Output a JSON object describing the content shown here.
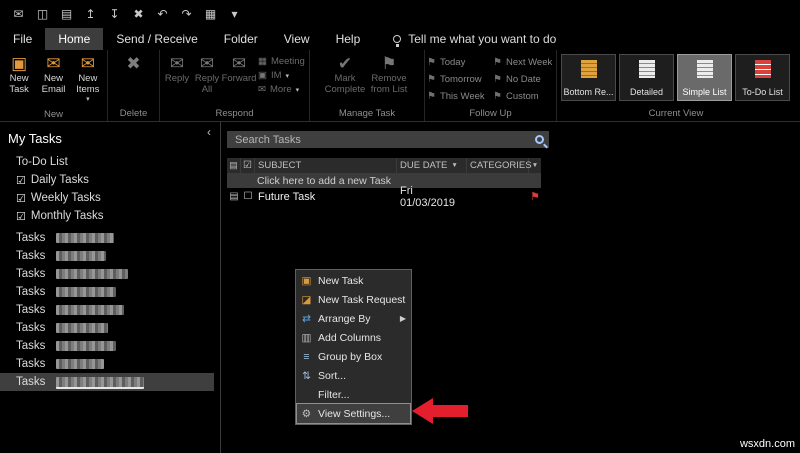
{
  "titlebar": {
    "icons": [
      {
        "name": "mail-icon",
        "glyph": "✉"
      },
      {
        "name": "save-icon",
        "glyph": "◫"
      },
      {
        "name": "print-icon",
        "glyph": "▤"
      },
      {
        "name": "move-up-icon",
        "glyph": "↥"
      },
      {
        "name": "move-down-icon",
        "glyph": "↧"
      },
      {
        "name": "delete-icon",
        "glyph": "✖"
      },
      {
        "name": "undo-icon",
        "glyph": "↶"
      },
      {
        "name": "redo-icon",
        "glyph": "↷"
      },
      {
        "name": "archive-icon",
        "glyph": "▦"
      },
      {
        "name": "more-commands-icon",
        "glyph": "▾"
      }
    ]
  },
  "tabs": {
    "file": "File",
    "home": "Home",
    "send_receive": "Send / Receive",
    "folder": "Folder",
    "view": "View",
    "help": "Help",
    "tell_me": "Tell me what you want to do"
  },
  "ribbon": {
    "new_group": {
      "label": "New",
      "new_task": "New Task",
      "new_email": "New Email",
      "new_items": "New Items"
    },
    "delete_group": {
      "label": "Delete"
    },
    "respond_group": {
      "label": "Respond",
      "reply": "Reply",
      "reply_all": "Reply All",
      "forward": "Forward",
      "meeting": "Meeting",
      "im": "IM",
      "more": "More"
    },
    "manage_group": {
      "label": "Manage Task",
      "mark_complete": "Mark Complete",
      "remove": "Remove from List"
    },
    "followup_group": {
      "label": "Follow Up",
      "items": [
        "Today",
        "Tomorrow",
        "This Week",
        "Next Week",
        "No Date",
        "Custom"
      ]
    },
    "view_group": {
      "label": "Current View",
      "items": [
        {
          "label": "Bottom Re..."
        },
        {
          "label": "Detailed"
        },
        {
          "label": "Simple List",
          "selected": true
        },
        {
          "label": "To-Do List"
        }
      ]
    }
  },
  "sidebar": {
    "title": "My Tasks",
    "todo": "To-Do List",
    "checked_items": [
      "Daily Tasks",
      "Weekly Tasks",
      "Monthly Tasks"
    ],
    "task_items": [
      {
        "label": "Tasks"
      },
      {
        "label": "Tasks"
      },
      {
        "label": "Tasks"
      },
      {
        "label": "Tasks"
      },
      {
        "label": "Tasks"
      },
      {
        "label": "Tasks"
      },
      {
        "label": "Tasks"
      },
      {
        "label": "Tasks"
      },
      {
        "label": "Tasks",
        "selected": true
      }
    ]
  },
  "content": {
    "search_placeholder": "Search Tasks",
    "table": {
      "col_subject": "SUBJECT",
      "col_due": "DUE DATE",
      "col_categories": "CATEGORIES",
      "add_row": "Click here to add a new Task",
      "rows": [
        {
          "subject": "Future Task",
          "due": "Fri 01/03/2019",
          "categories": ""
        }
      ]
    }
  },
  "menu": {
    "items": [
      {
        "label": "New Task"
      },
      {
        "label": "New Task Request"
      },
      {
        "label": "Arrange By"
      },
      {
        "label": "Add Columns"
      },
      {
        "label": "Group by Box"
      },
      {
        "label": "Sort..."
      },
      {
        "label": "Filter..."
      },
      {
        "label": "View Settings...",
        "highlighted": true
      }
    ]
  },
  "watermark": "wsxdn.com",
  "colors": {
    "accent_red": "#e31e2d",
    "icon_orange": "#e09a3e",
    "selected_grey": "#6a6a6a"
  }
}
